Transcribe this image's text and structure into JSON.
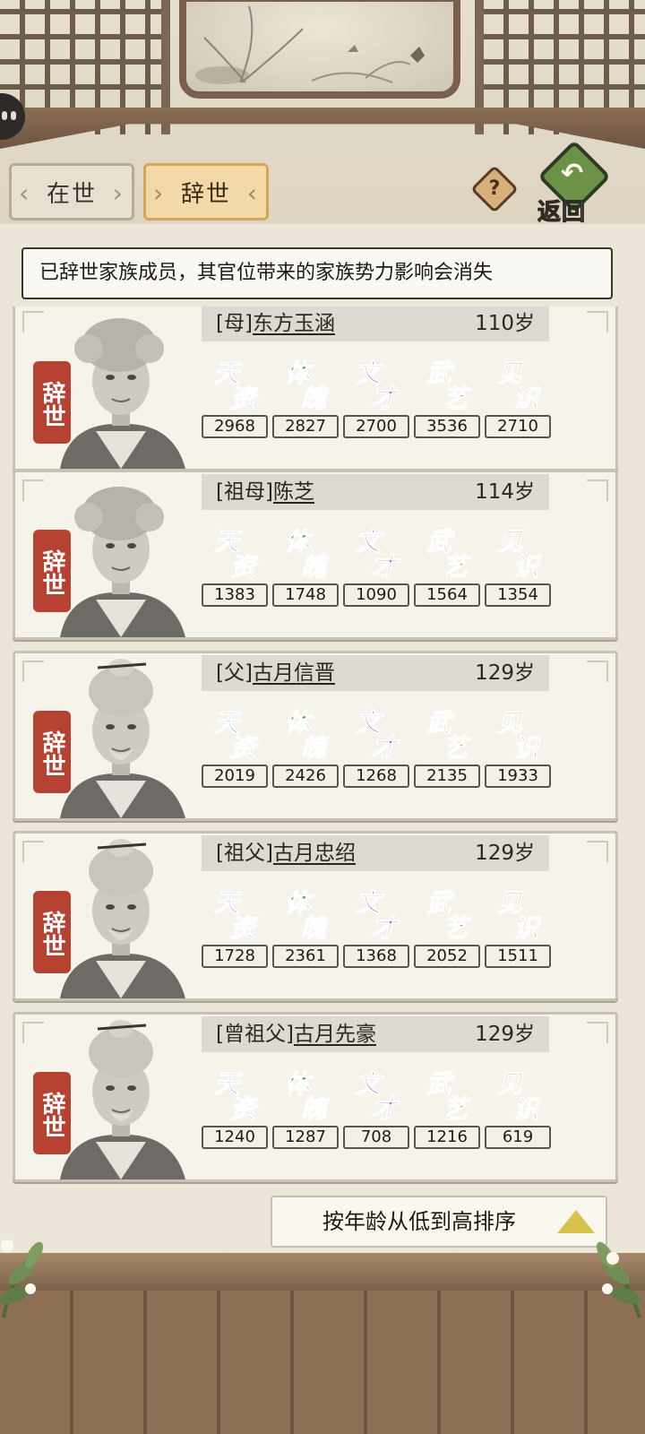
{
  "tabs": {
    "alive_label": "在世",
    "deceased_label": "辞世",
    "selected": "deceased"
  },
  "help_symbol": "?",
  "back_label": "返回",
  "notice": "已辞世家族成员，其官位带来的家族势力影响会消失",
  "stat_glyphs": {
    "talent": [
      "天",
      "资"
    ],
    "physique": [
      "体",
      "魄"
    ],
    "literary": [
      "文",
      "才"
    ],
    "martial": [
      "武",
      "艺"
    ],
    "insight": [
      "见",
      "识"
    ]
  },
  "stat_colors": {
    "talent": "#2f6fd6",
    "physique": "#2c9a4a",
    "literary": "#9b36c8",
    "martial": "#c99a24",
    "insight": "#c74a45"
  },
  "members": [
    {
      "status": "辞世",
      "relation": "[母]",
      "name": "东方玉涵",
      "age": "110岁",
      "stats": [
        "2968",
        "2827",
        "2700",
        "3536",
        "2710"
      ]
    },
    {
      "status": "辞世",
      "relation": "[祖母]",
      "name": "陈芝",
      "age": "114岁",
      "stats": [
        "1383",
        "1748",
        "1090",
        "1564",
        "1354"
      ]
    },
    {
      "status": "辞世",
      "relation": "[父]",
      "name": "古月信晋",
      "age": "129岁",
      "stats": [
        "2019",
        "2426",
        "1268",
        "2135",
        "1933"
      ]
    },
    {
      "status": "辞世",
      "relation": "[祖父]",
      "name": "古月忠绍",
      "age": "129岁",
      "stats": [
        "1728",
        "2361",
        "1368",
        "2052",
        "1511"
      ]
    },
    {
      "status": "辞世",
      "relation": "[曾祖父]",
      "name": "古月先豪",
      "age": "129岁",
      "stats": [
        "1240",
        "1287",
        "708",
        "1216",
        "619"
      ]
    }
  ],
  "sort_label": "按年龄从低到高排序",
  "status_color": "#b84232"
}
